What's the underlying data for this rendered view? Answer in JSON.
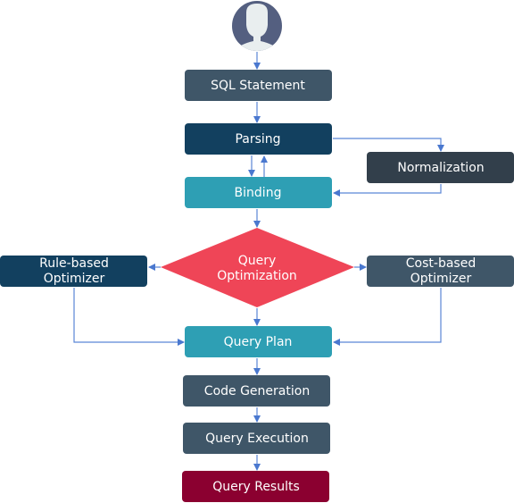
{
  "colors": {
    "slate": "#3f5668",
    "navy": "#12405f",
    "charcoal": "#323f4b",
    "teal": "#2e9fb4",
    "red": "#ef4557",
    "maroon": "#8b0030",
    "arrow": "#5b86d6",
    "avatar_bg": "#545f80",
    "avatar_fg": "#e9eeef"
  },
  "user": {
    "icon": "user-avatar-icon"
  },
  "nodes": {
    "sql_statement": "SQL Statement",
    "parsing": "Parsing",
    "normalization": "Normalization",
    "binding": "Binding",
    "query_optimization": [
      "Query",
      "Optimization"
    ],
    "rule_based": [
      "Rule-based",
      "Optimizer"
    ],
    "cost_based": [
      "Cost-based",
      "Optimizer"
    ],
    "query_plan": "Query Plan",
    "code_generation": "Code Generation",
    "query_execution": "Query Execution",
    "query_results": "Query Results"
  }
}
